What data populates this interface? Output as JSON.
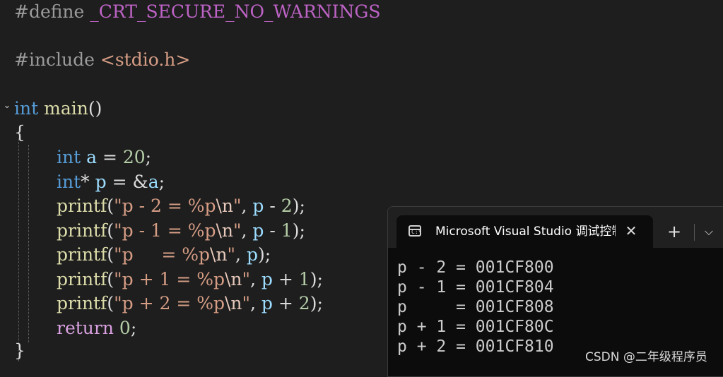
{
  "editor": {
    "lines": [
      {
        "parts": [
          {
            "cls": "pre",
            "text": "#define "
          },
          {
            "cls": "macro",
            "text": "_CRT_SECURE_NO_WARNINGS"
          }
        ]
      },
      {
        "parts": [
          {
            "cls": "pre",
            "text": "#include "
          },
          {
            "cls": "str",
            "text": "<stdio.h>"
          }
        ]
      },
      {
        "parts": [
          {
            "cls": "kw",
            "text": "int"
          },
          {
            "cls": "plain",
            "text": " "
          },
          {
            "cls": "fn",
            "text": "main"
          },
          {
            "cls": "plain",
            "text": "()"
          }
        ]
      },
      {
        "parts": [
          {
            "cls": "plain",
            "text": "{"
          }
        ]
      },
      {
        "parts": [
          {
            "cls": "kw",
            "text": "int"
          },
          {
            "cls": "plain",
            "text": " "
          },
          {
            "cls": "var",
            "text": "a"
          },
          {
            "cls": "plain",
            "text": " = "
          },
          {
            "cls": "num",
            "text": "20"
          },
          {
            "cls": "plain",
            "text": ";"
          }
        ]
      },
      {
        "parts": [
          {
            "cls": "kw",
            "text": "int"
          },
          {
            "cls": "plain",
            "text": "* "
          },
          {
            "cls": "var",
            "text": "p"
          },
          {
            "cls": "plain",
            "text": " = &"
          },
          {
            "cls": "var",
            "text": "a"
          },
          {
            "cls": "plain",
            "text": ";"
          }
        ]
      },
      {
        "parts": [
          {
            "cls": "fn",
            "text": "printf"
          },
          {
            "cls": "plain",
            "text": "("
          },
          {
            "cls": "str",
            "text": "\"p - 2 = %p"
          },
          {
            "cls": "esc",
            "text": "\\n"
          },
          {
            "cls": "str",
            "text": "\""
          },
          {
            "cls": "plain",
            "text": ", "
          },
          {
            "cls": "var",
            "text": "p"
          },
          {
            "cls": "plain",
            "text": " - "
          },
          {
            "cls": "num",
            "text": "2"
          },
          {
            "cls": "plain",
            "text": ");"
          }
        ]
      },
      {
        "parts": [
          {
            "cls": "fn",
            "text": "printf"
          },
          {
            "cls": "plain",
            "text": "("
          },
          {
            "cls": "str",
            "text": "\"p - 1 = %p"
          },
          {
            "cls": "esc",
            "text": "\\n"
          },
          {
            "cls": "str",
            "text": "\""
          },
          {
            "cls": "plain",
            "text": ", "
          },
          {
            "cls": "var",
            "text": "p"
          },
          {
            "cls": "plain",
            "text": " - "
          },
          {
            "cls": "num",
            "text": "1"
          },
          {
            "cls": "plain",
            "text": ");"
          }
        ]
      },
      {
        "parts": [
          {
            "cls": "fn",
            "text": "printf"
          },
          {
            "cls": "plain",
            "text": "("
          },
          {
            "cls": "str",
            "text": "\"p     = %p"
          },
          {
            "cls": "esc",
            "text": "\\n"
          },
          {
            "cls": "str",
            "text": "\""
          },
          {
            "cls": "plain",
            "text": ", "
          },
          {
            "cls": "var",
            "text": "p"
          },
          {
            "cls": "plain",
            "text": ");"
          }
        ]
      },
      {
        "parts": [
          {
            "cls": "fn",
            "text": "printf"
          },
          {
            "cls": "plain",
            "text": "("
          },
          {
            "cls": "str",
            "text": "\"p + 1 = %p"
          },
          {
            "cls": "esc",
            "text": "\\n"
          },
          {
            "cls": "str",
            "text": "\""
          },
          {
            "cls": "plain",
            "text": ", "
          },
          {
            "cls": "var",
            "text": "p"
          },
          {
            "cls": "plain",
            "text": " + "
          },
          {
            "cls": "num",
            "text": "1"
          },
          {
            "cls": "plain",
            "text": ");"
          }
        ]
      },
      {
        "parts": [
          {
            "cls": "fn",
            "text": "printf"
          },
          {
            "cls": "plain",
            "text": "("
          },
          {
            "cls": "str",
            "text": "\"p + 2 = %p"
          },
          {
            "cls": "esc",
            "text": "\\n"
          },
          {
            "cls": "str",
            "text": "\""
          },
          {
            "cls": "plain",
            "text": ", "
          },
          {
            "cls": "var",
            "text": "p"
          },
          {
            "cls": "plain",
            "text": " + "
          },
          {
            "cls": "num",
            "text": "2"
          },
          {
            "cls": "plain",
            "text": ");"
          }
        ]
      },
      {
        "parts": [
          {
            "cls": "ctl",
            "text": "return"
          },
          {
            "cls": "plain",
            "text": " "
          },
          {
            "cls": "num",
            "text": "0"
          },
          {
            "cls": "plain",
            "text": ";"
          }
        ]
      },
      {
        "parts": [
          {
            "cls": "plain",
            "text": "}"
          }
        ]
      }
    ]
  },
  "terminal": {
    "title": "Microsoft Visual Studio 调试控制台",
    "close_symbol": "✕",
    "new_tab_symbol": "+",
    "dropdown_symbol": "⌵",
    "output": [
      "p - 2 = 001CF800",
      "p - 1 = 001CF804",
      "p     = 001CF808",
      "p + 1 = 001CF80C",
      "p + 2 = 001CF810"
    ]
  },
  "watermark": "CSDN @二年级程序员",
  "colors": {
    "editor_bg": "#1e1e1e",
    "keyword": "#569cd6",
    "function": "#dcdcaa",
    "string": "#d69d85",
    "number": "#b5cea8",
    "terminal_bg": "#0c0c0c"
  }
}
